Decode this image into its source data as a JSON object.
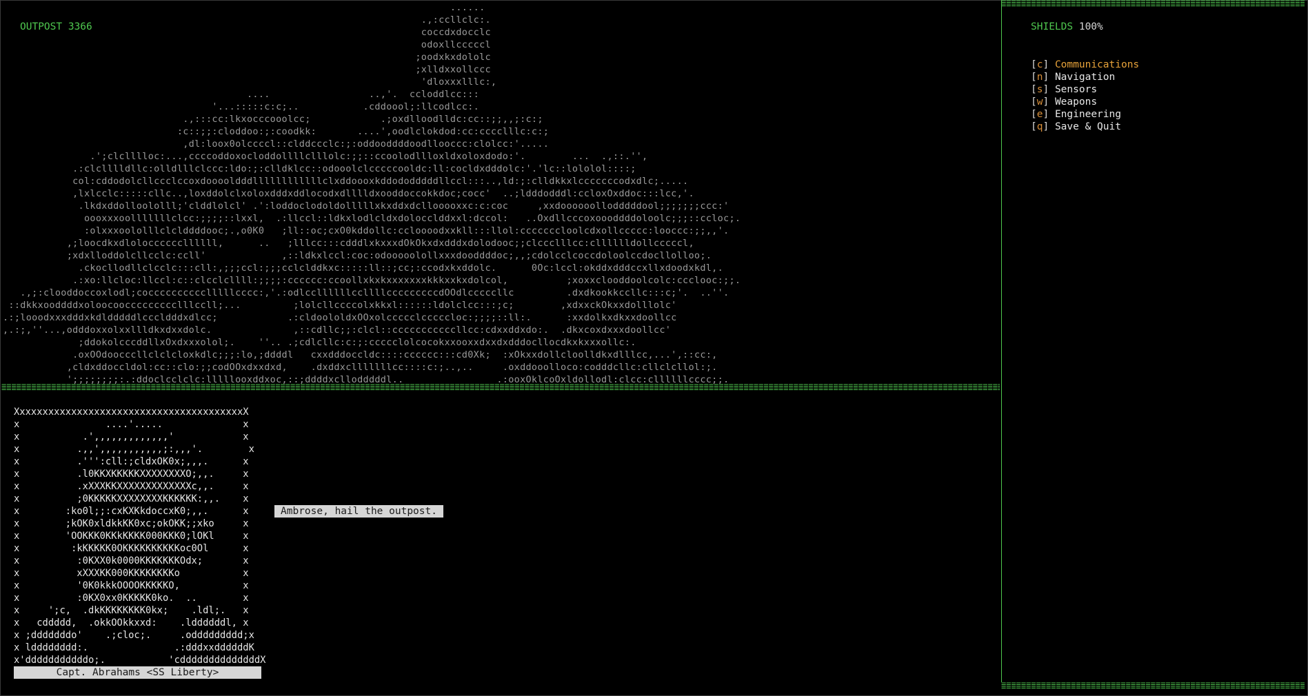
{
  "location": {
    "title": "OUTPOST 3366",
    "art": "                                                                             ......\n                                                                        .,:ccllclc:.\n                                                                        coccdxdocclc\n                                                                        odoxllcccccl\n                                                                       ;oodxkxdololc\n                                                                       ;xlldxxollccc\n                                                                        'dloxxxlllc:,\n                                          ....                 ..,'.  ccloddlcc:::\n                                    '...:::::c:c;..           .cddoool;:llcodlcc:.\n                               .,:::cc:lkxocccooolcc;            .;oxdlloodlldc:cc::;;,,;:c:;\n                              :c::;;:cloddoo:;:coodkk:       ....',oodlclokdod:cc:cccclllc:c:;\n                               ,dl:loox0olccccl::clddccclc:;:oddooddddoodllooccc:clolcc:'.....\n               .';clclllloc:...,ccccoddoxocloddollllclllolc:;;::ccoolodllloxldxoloxdodo:'.        ...  .,::.'',\n            .:clclllldllc:olldlllclccc:ldo:;:clldklcc::odooolclcccccooldc:ll:cocldxdddolc:'.'lc::lololol::::;\n            col:cddodolcllccclccoxdooooldddllllllllllllclxddoooxkddododddddllccl:::..,ld:;:clldkkxlcccccccodxdlc;.....\n            ,lxlcclc:::::cllc..,loxddolclxoloxdddxddlocodxdlllldxooddoccokkdoc;cocc'  ..;ldddodddl:ccloxOxddoc:::lcc,'.\n             .lkdxddolloololll;'clddlolcl' .':loddoclodoldolllllxkxddxdcllooooxxc:c:coc     ,xxdoooooollodddddool;;;;;;;ccc:'\n              oooxxxoolllllllclcc:;;;;::lxxl,  .:llccl::ldkxlodlcldxdolocclddxxl:dccol:   ..Oxdllcccoxoooddddoloolc;;;::ccloc;.\n              :olxxxoololllclclddddooc;.,o0K0   ;ll::oc;cxO0kddollc:ccloooodxxkll:::llol:cccccccloolcdxollccccc:looccc:;;,,'.\n           ,;loocdkxdloloccccccllllll,      ..   ;lllcc:::cdddlxkxxxdOkOkxdxdddxdolodooc;;clccclllcc:clllllldollcccccl,\n           ;xdxlloddolcllcclc:ccll'             ,::ldkxlccl:coc:odooooolollxxxdooddddoc;,,;cdolcclcoccdoloolccdocllolloo;.\n             .ckocllodllclcclc:::cll:,;;;ccl:;;;cclclddkxc:::::ll::;cc;:ccodxkxddolc.      0Oc:lccl:okddxdddccxllxdoodxkdl,.\n            .:xo:llcloc:llccl:c::clcclcllll:;;;;:cccccc:ccoollxkxkxxxxxxxkkkxxkxdolcol,          ;xoxxclooddoolcolc:ccclooc:;;.\n   .,;:clooddoccoxlodl;cocccccccccclllllcccc:,'.:odlccllllllccllllcccccccccdOOdlcccccllc         .dxdkookkccllc:::c;'.  ..''.\n ::dkkxooddddxoloocooccccccccclllccll;...         ;lolcllccccolxkkxl::::::ldolclcc:::;c;        ,xdxxckOkxxdolllolc'\n.:;looodxxxdddxkdldddddlcccldddxdlcc;            .:cldoololdxOOxolccccclcccccloc:;;;;::ll:.      :xxdolkxdkxxdoollcc\n,.:;,''...,odddoxxolxxllldkxdxxdolc.              ,::cdllc;;:clcl::cccccccccccllcc:cdxxddxdo:.  .dkxcoxdxxxdoollcc'\n             ;ddokolcccddllxOxdxxxolol;.    ''.. .;cdlcllc:c:;:ccccclolcocokxxooxxdxxdxdddocllocdkxkxxxollc:.\n            .oxOOdoocccllclclcloxkdlc;;;:lo,;ddddl   cxxdddoccldc::::cccccc:::cd0Xk;  :xOkxxdollcloolldkxdlllcc,...',::cc:,\n           ,cldxddoccldol:cc::clo:;;codOOxdxxdxd,    .dxddxclllllllcc::::c:;..,..     .oxddooolloco:codddcllc:cllclcllol:;.\n           ';;;;;;;;:.:ddoclcclclc:lllllooxddxoc,::;ddddxcllodddddl..                .:ooxOklcoOxldollodl:clcc:cllllllcccc;;."
  },
  "status": {
    "shields_label": "SHIELDS",
    "shields_value": "100%"
  },
  "menu": [
    {
      "key": "c",
      "label": "Communications",
      "active": true
    },
    {
      "key": "n",
      "label": "Navigation",
      "active": false
    },
    {
      "key": "s",
      "label": "Sensors",
      "active": false
    },
    {
      "key": "w",
      "label": "Weapons",
      "active": false
    },
    {
      "key": "e",
      "label": "Engineering",
      "active": false
    },
    {
      "key": "q",
      "label": "Save & Quit",
      "active": false
    }
  ],
  "portrait": {
    "name": "Capt. Abrahams <SS Liberty>",
    "art": "XxxxxxxxxxxxxxxxxxxxxxxxxxxxxxxxxxxxxxxxX\nx               ....'.....              x\nx           .',,,,,,,,,,,,,'            x\nx          .,,',,,,,,,,,,,;:,,,'.        x\nx          .''':cll:;cldxOK0x;,,,.      x\nx          .l0KKXKKKKKXXXXXXXXO;,,.     x\nx          .xXXXKKXXXXXXXXXXXXXc,,.     x\nx          ;0KKKKKXXXXXXXXKKKKKK:,,.    x\nx        :ko0l;;:cxKXKkdoccxK0;,,.      x\nx        ;kOK0xldkkKK0xc;okOKK;;xko     x\nx        'OOKKK0KKkKKKK000KKK0;lOKl     x\nx         :kKKKKK0OKKKKKKKKKKoc0Ol      x\nx          :0KXX0k0000KKKKKKKOdx;       x\nx          xXXXKK000KKKKKKKKo           x\nx          '0K0kkkOOOOKKKKKO,           x\nx          :0KX0xx0KKKKK0ko.  ..        x\nx     ';c,  .dkKKKKKKKK0kx;    .ldl;.   x\nx   cddddd,  .okkOOkkxxd:    .lddddddl, x\nx ;dddddddo'    .;cloc;.     .oddddddddd;x\nx ldddddddd:.               .:dddxxddddddK\nx'dddddddddddo;.           'cddddddddddddddX"
  },
  "dialog": {
    "option": "Ambrose, hail the outpost."
  }
}
